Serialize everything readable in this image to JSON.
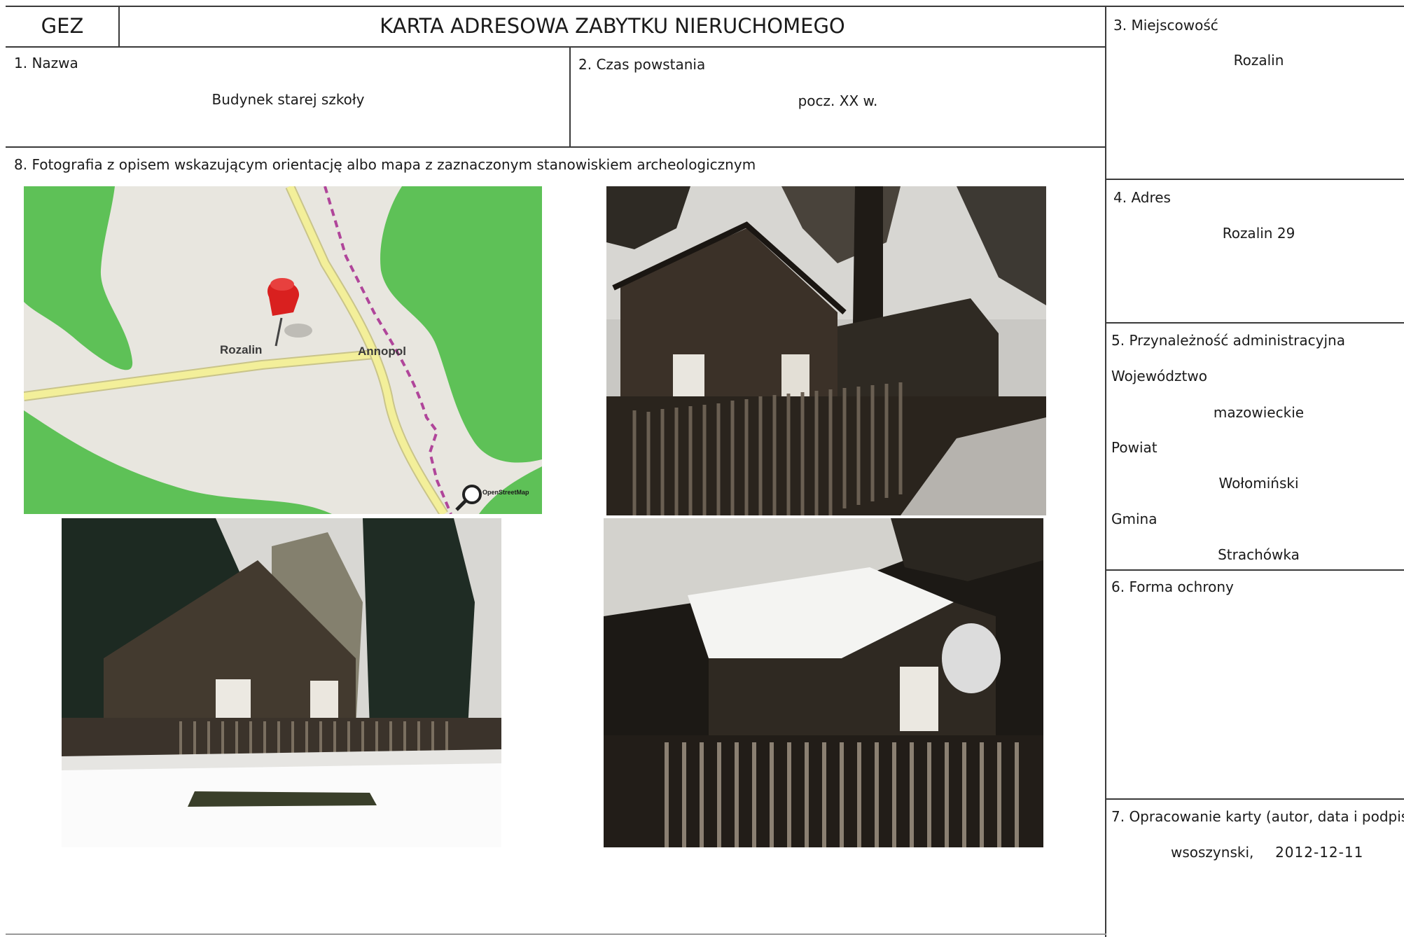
{
  "header": {
    "code": "GEZ",
    "title": "KARTA ADRESOWA ZABYTKU NIERUCHOMEGO"
  },
  "fields": {
    "name": {
      "label": "1. Nazwa",
      "value": "Budynek starej szkoły"
    },
    "period": {
      "label": "2. Czas powstania",
      "value": "pocz. XX w."
    },
    "locality": {
      "label": "3. Miejscowość",
      "value": "Rozalin"
    },
    "address": {
      "label": "4. Adres",
      "value": "Rozalin 29"
    },
    "admin": {
      "label": "5. Przynależność administracyjna",
      "voivodeship_label": "Województwo",
      "voivodeship": "mazowieckie",
      "county_label": "Powiat",
      "county": "Wołomiński",
      "commune_label": "Gmina",
      "commune": "Strachówka"
    },
    "protection": {
      "label": "6. Forma ochrony",
      "value": ""
    },
    "prepared": {
      "label": "7. Opracowanie karty (autor, data i podpis)",
      "author": "wsoszynski,",
      "date": "2012-12-11"
    },
    "photos": {
      "label": "8. Fotografia z opisem wskazującym orientację albo mapa z zaznaczonym stanowiskiem archeologicznym"
    }
  },
  "map": {
    "place_label": "Rozalin",
    "road_label": "Annopol",
    "logo_text": "OpenStreetMap",
    "colors": {
      "forest": "#5ec157",
      "land": "#e8e6df",
      "road": "#f3ef9a",
      "boundary": "#b0459a",
      "pin": "#d9201f"
    }
  }
}
